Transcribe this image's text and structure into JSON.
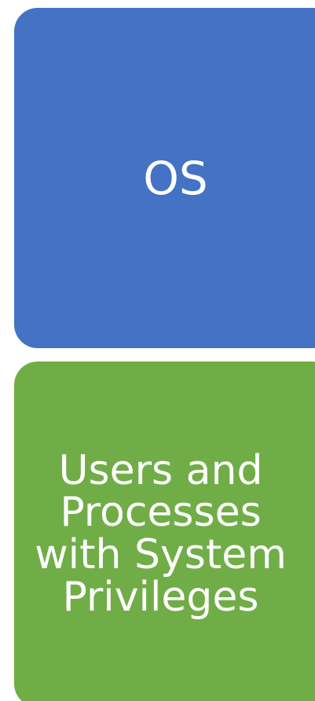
{
  "blocks": [
    {
      "label": "OS",
      "color": "#4472C4"
    },
    {
      "label": "Users and Processes with System Privileges",
      "color": "#70AD47"
    }
  ]
}
